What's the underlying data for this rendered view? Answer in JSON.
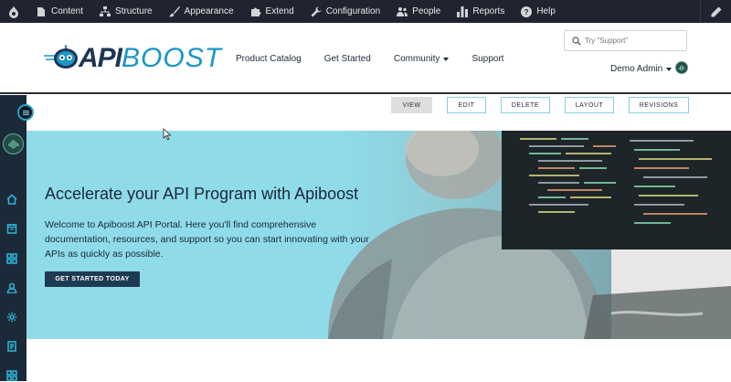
{
  "admin_toolbar": {
    "items": [
      {
        "label": "Content",
        "icon": "file-icon"
      },
      {
        "label": "Structure",
        "icon": "structure-icon"
      },
      {
        "label": "Appearance",
        "icon": "brush-icon"
      },
      {
        "label": "Extend",
        "icon": "puzzle-icon"
      },
      {
        "label": "Configuration",
        "icon": "wrench-icon"
      },
      {
        "label": "People",
        "icon": "people-icon"
      },
      {
        "label": "Reports",
        "icon": "bar-chart-icon"
      },
      {
        "label": "Help",
        "icon": "help-icon"
      }
    ]
  },
  "header": {
    "logo_api": "API",
    "logo_boost": "BOOST",
    "nav": [
      "Product Catalog",
      "Get Started",
      "Community",
      "Support"
    ],
    "search_placeholder": "Try \"Support\"",
    "user_name": "Demo Admin"
  },
  "tasks": [
    "VIEW",
    "EDIT",
    "DELETE",
    "LAYOUT",
    "REVISIONS"
  ],
  "hero": {
    "title": "Accelerate your API Program with Apiboost",
    "text": "Welcome to Apiboost API Portal. Here you'll find comprehensive documentation, resources, and support so you can start innovating with your APIs as quickly as possible.",
    "cta": "GET STARTED TODAY"
  },
  "colors": {
    "admin_bar": "#222330",
    "sidebar": "#1a2a38",
    "accent": "#2fb0d4",
    "hero_bg": "#8fdbea",
    "cta_bg": "#1e3a52"
  }
}
